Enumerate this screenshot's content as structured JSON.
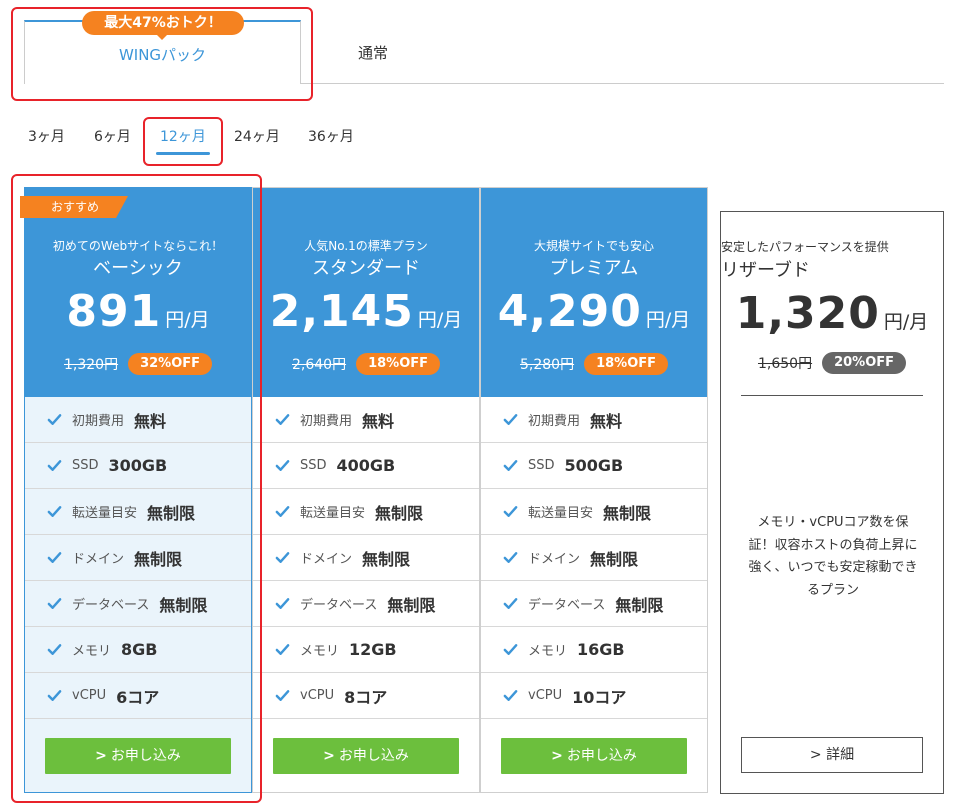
{
  "pack_tabs": {
    "promo_badge": "最大47%おトク！",
    "wing_label": "WINGパック",
    "normal_label": "通常"
  },
  "period_tabs": [
    {
      "label": "3ヶ月",
      "active": false
    },
    {
      "label": "6ヶ月",
      "active": false
    },
    {
      "label": "12ヶ月",
      "active": true
    },
    {
      "label": "24ヶ月",
      "active": false
    },
    {
      "label": "36ヶ月",
      "active": false
    }
  ],
  "plans": [
    {
      "badge": "おすすめ",
      "catch": "初めてのWebサイトならこれ！",
      "name": "ベーシック",
      "price": "891",
      "price_unit": "円/月",
      "orig_price": "1,320円",
      "discount": "32%OFF",
      "features": [
        {
          "label": "初期費用",
          "value": "無料"
        },
        {
          "label": "SSD",
          "value": "300GB"
        },
        {
          "label": "転送量目安",
          "value": "無制限"
        },
        {
          "label": "ドメイン",
          "value": "無制限"
        },
        {
          "label": "データベース",
          "value": "無制限"
        },
        {
          "label": "メモリ",
          "value": "8GB"
        },
        {
          "label": "vCPU",
          "value": "6コア"
        }
      ],
      "button": "お申し込み"
    },
    {
      "catch": "人気No.1の標準プラン",
      "name": "スタンダード",
      "price": "2,145",
      "price_unit": "円/月",
      "orig_price": "2,640円",
      "discount": "18%OFF",
      "features": [
        {
          "label": "初期費用",
          "value": "無料"
        },
        {
          "label": "SSD",
          "value": "400GB"
        },
        {
          "label": "転送量目安",
          "value": "無制限"
        },
        {
          "label": "ドメイン",
          "value": "無制限"
        },
        {
          "label": "データベース",
          "value": "無制限"
        },
        {
          "label": "メモリ",
          "value": "12GB"
        },
        {
          "label": "vCPU",
          "value": "8コア"
        }
      ],
      "button": "お申し込み"
    },
    {
      "catch": "大規模サイトでも安心",
      "name": "プレミアム",
      "price": "4,290",
      "price_unit": "円/月",
      "orig_price": "5,280円",
      "discount": "18%OFF",
      "features": [
        {
          "label": "初期費用",
          "value": "無料"
        },
        {
          "label": "SSD",
          "value": "500GB"
        },
        {
          "label": "転送量目安",
          "value": "無制限"
        },
        {
          "label": "ドメイン",
          "value": "無制限"
        },
        {
          "label": "データベース",
          "value": "無制限"
        },
        {
          "label": "メモリ",
          "value": "16GB"
        },
        {
          "label": "vCPU",
          "value": "10コア"
        }
      ],
      "button": "お申し込み"
    }
  ],
  "reserved": {
    "catch": "安定したパフォーマンスを提供",
    "name": "リザーブド",
    "price": "1,320",
    "price_unit": "円/月",
    "orig_price": "1,650円",
    "discount": "20%OFF",
    "description": "メモリ・vCPUコア数を保証！収容ホストの負荷上昇に強く、いつでも安定稼動できるプラン",
    "button": "詳細"
  },
  "colors": {
    "accent_blue": "#3d96d8",
    "promo_orange": "#f58220",
    "apply_green": "#6cbf3d",
    "highlight_red": "#e8232a",
    "reserved_pill": "#666666"
  }
}
